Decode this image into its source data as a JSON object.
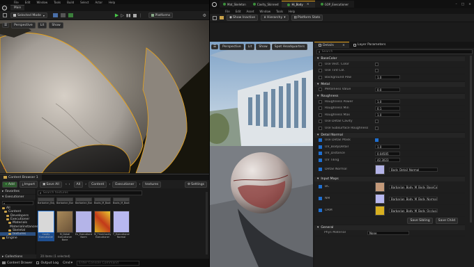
{
  "menu": [
    "File",
    "Edit",
    "Window",
    "Tools",
    "Build",
    "Select",
    "Actor",
    "Help"
  ],
  "level_tab": "Main",
  "selection_mode": "Selected Mode",
  "platforms": "Platforms",
  "viewport": {
    "mode": "Perspective",
    "lit": "Lit",
    "show": "Show"
  },
  "material_editor": {
    "tabs": [
      "Mat_Skeleton",
      "Cavity_Skinned",
      "Hi_Body",
      "GOP_Executioner"
    ],
    "menu": [
      "File",
      "Edit",
      "Asset",
      "Window",
      "Tools",
      "Help"
    ],
    "toolbar": [
      "Show Inactive",
      "Hierarchy",
      "Platform Stats"
    ],
    "preview": {
      "mode": "Perspective",
      "lit": "Lit",
      "show": "Show",
      "profile": "Spot Headquarters"
    }
  },
  "details": {
    "tabs": [
      "Details",
      "Layer Parameters"
    ],
    "search_placeholder": "Search",
    "sections": [
      {
        "title": "BaseColor",
        "rows": [
          {
            "label": "Use Vect. Color",
            "type": "check",
            "on": false
          },
          {
            "label": "Use Tint Col.",
            "type": "check",
            "on": false
          },
          {
            "label": "Background Pow",
            "value": "1.0"
          }
        ]
      },
      {
        "title": "Metal",
        "rows": [
          {
            "label": "Metalness Value",
            "value": "0.0"
          }
        ]
      },
      {
        "title": "Roughness",
        "rows": [
          {
            "label": "Roughness Power",
            "value": "1.0"
          },
          {
            "label": "Roughness Min",
            "value": "0.1"
          },
          {
            "label": "Roughness Max",
            "value": "1.0"
          },
          {
            "label": "Use Detail Cavity",
            "type": "check",
            "on": false
          },
          {
            "label": "Use Subsurface Roughness",
            "type": "check",
            "on": false
          }
        ]
      },
      {
        "title": "Detail Normal",
        "rows": [
          {
            "label": "Use Detail Mask",
            "type": "check",
            "on": true
          },
          {
            "label": "UV_BodyDetail",
            "value": "1.0"
          },
          {
            "label": "UV_Distance",
            "value": "0.04505"
          },
          {
            "label": "UV Tiling",
            "value": "42.3023"
          },
          {
            "label": "Detail Normal",
            "type": "tex",
            "value": "Body_Detail_Normal"
          }
        ]
      },
      {
        "title": "Input Maps",
        "rows": [
          {
            "label": "BC",
            "type": "tex",
            "value": "Barbarian_Body_M_Body_BaseColor"
          },
          {
            "label": "NM",
            "type": "tex",
            "value": "Barbarian_Body_M_Body_Normal"
          },
          {
            "label": "ORM",
            "type": "tex",
            "value": "Barbarian_Body_M_Body_OcclusionRoughMetal"
          }
        ]
      }
    ],
    "save_sibling": "Save Sibling",
    "save_child": "Save Child",
    "general_title": "General",
    "phys_label": "Phys Material",
    "phys_value": "None"
  },
  "content_browser": {
    "title": "Content Browser 1",
    "add": "Add",
    "import": "Import",
    "save_all": "Save All",
    "path": [
      "All",
      "Content",
      "Executioner",
      "textures"
    ],
    "settings": "Settings",
    "search_placeholder": "Search textures",
    "favorites": "Favorites",
    "root": "Executioner",
    "tree": [
      "All",
      "Content",
      "Developers",
      "Executioner",
      "Materials",
      "Materialinstances",
      "Skeletal",
      "textures",
      "Engine"
    ],
    "collections": "Collections",
    "items_status": "20 items (1 selected)",
    "assets": [
      {
        "name": "Barbarian_Bdy_M_Body_Norm",
        "bg": "#8a8a8a"
      },
      {
        "name": "Barbarian_Body_M_Body_BC",
        "bg": "#6a5a4a"
      },
      {
        "name": "Barbarian_Body_M_Body_NM",
        "bg": "#4c4a48"
      },
      {
        "name": "Boots_M_Boots_BC",
        "bg": "#6a6258"
      },
      {
        "name": "Boots_M_Boots_NM",
        "bg": "#5a5a5a"
      }
    ],
    "assets2": [
      {
        "name": "Cavity Executioner",
        "bg": "#d8d8d8"
      },
      {
        "name": "M_Detail Executioner Bone",
        "bg": "#8a6e48"
      },
      {
        "name": "Ex_Executioner Norm",
        "bg": "#b4b4e8"
      },
      {
        "name": "M_ThickCavity Executioner",
        "bg": "#d8b020"
      },
      {
        "name": "T_Executioner Normal",
        "bg": "#b8b8f0"
      }
    ]
  },
  "status": {
    "drawer": "Content Drawer",
    "log": "Output Log",
    "cmd": "Cmd",
    "console_placeholder": "Enter Console Command"
  },
  "colors": {
    "accent": "#e6a21c",
    "blue": "#1f6fd0",
    "viewport_bg": "#1c1a10"
  }
}
